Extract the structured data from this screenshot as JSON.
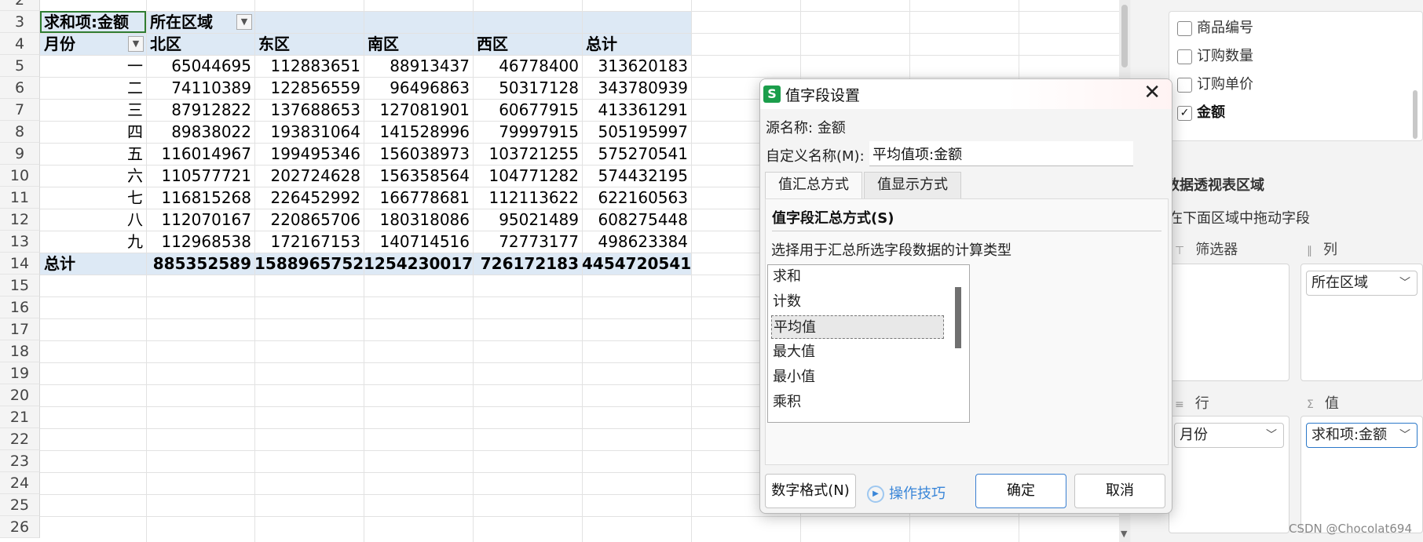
{
  "sheet": {
    "row_numbers": [
      "2",
      "3",
      "4",
      "5",
      "6",
      "7",
      "8",
      "9",
      "10",
      "11",
      "12",
      "13",
      "14",
      "15",
      "16",
      "17",
      "18",
      "19",
      "20",
      "21",
      "22",
      "23",
      "24",
      "25",
      "26"
    ],
    "header": {
      "a3": "求和项:金额",
      "b3": "所在区域",
      "a4": "月份",
      "columns": [
        "北区",
        "东区",
        "南区",
        "西区",
        "总计"
      ]
    },
    "rows": [
      {
        "month": "一",
        "values": [
          "65044695",
          "112883651",
          "88913437",
          "46778400",
          "313620183"
        ]
      },
      {
        "month": "二",
        "values": [
          "74110389",
          "122856559",
          "96496863",
          "50317128",
          "343780939"
        ]
      },
      {
        "month": "三",
        "values": [
          "87912822",
          "137688653",
          "127081901",
          "60677915",
          "413361291"
        ]
      },
      {
        "month": "四",
        "values": [
          "89838022",
          "193831064",
          "141528996",
          "79997915",
          "505195997"
        ]
      },
      {
        "month": "五",
        "values": [
          "116014967",
          "199495346",
          "156038973",
          "103721255",
          "575270541"
        ]
      },
      {
        "month": "六",
        "values": [
          "110577721",
          "202724628",
          "156358564",
          "104771282",
          "574432195"
        ]
      },
      {
        "month": "七",
        "values": [
          "116815268",
          "226452992",
          "166778681",
          "112113622",
          "622160563"
        ]
      },
      {
        "month": "八",
        "values": [
          "112070167",
          "220865706",
          "180318086",
          "95021489",
          "608275448"
        ]
      },
      {
        "month": "九",
        "values": [
          "112968538",
          "172167153",
          "140714516",
          "72773177",
          "498623384"
        ]
      }
    ],
    "total": {
      "label": "总计",
      "values": [
        "885352589",
        "1588965752",
        "1254230017",
        "726172183",
        "4454720541"
      ]
    }
  },
  "field_list": {
    "items": [
      {
        "label": "商品编号",
        "checked": false
      },
      {
        "label": "订购数量",
        "checked": false
      },
      {
        "label": "订购单价",
        "checked": false
      },
      {
        "label": "金额",
        "checked": true
      }
    ],
    "check_mark": "✓"
  },
  "pivot_areas": {
    "title": "数据透视表区域",
    "hint": "在下面区域中拖动字段",
    "filter_label": "筛选器",
    "columns_label": "列",
    "rows_label": "行",
    "values_label": "值",
    "columns_field": "所在区域",
    "rows_field": "月份",
    "values_field": "求和项:金额"
  },
  "dialog": {
    "app_icon": "S",
    "title": "值字段设置",
    "close": "✕",
    "source_label": "源名称:",
    "source_value": "金额",
    "custom_name_label": "自定义名称(M):",
    "custom_name_value": "平均值项:金额",
    "tabs": [
      "值汇总方式",
      "值显示方式"
    ],
    "section_title": "值字段汇总方式(S)",
    "instruction": "选择用于汇总所选字段数据的计算类型",
    "summary_options": [
      "求和",
      "计数",
      "平均值",
      "最大值",
      "最小值",
      "乘积"
    ],
    "selected_option": "平均值",
    "number_format_button": "数字格式(N)",
    "tips_link": "操作技巧",
    "ok_button": "确定",
    "cancel_button": "取消"
  },
  "watermark": "CSDN @Chocolat694",
  "colors": {
    "accent_blue": "#3a86d8",
    "pivot_header_band": "#dde9f5",
    "selection_green": "#2f7d32",
    "app_icon_green": "#1b9e4b"
  }
}
